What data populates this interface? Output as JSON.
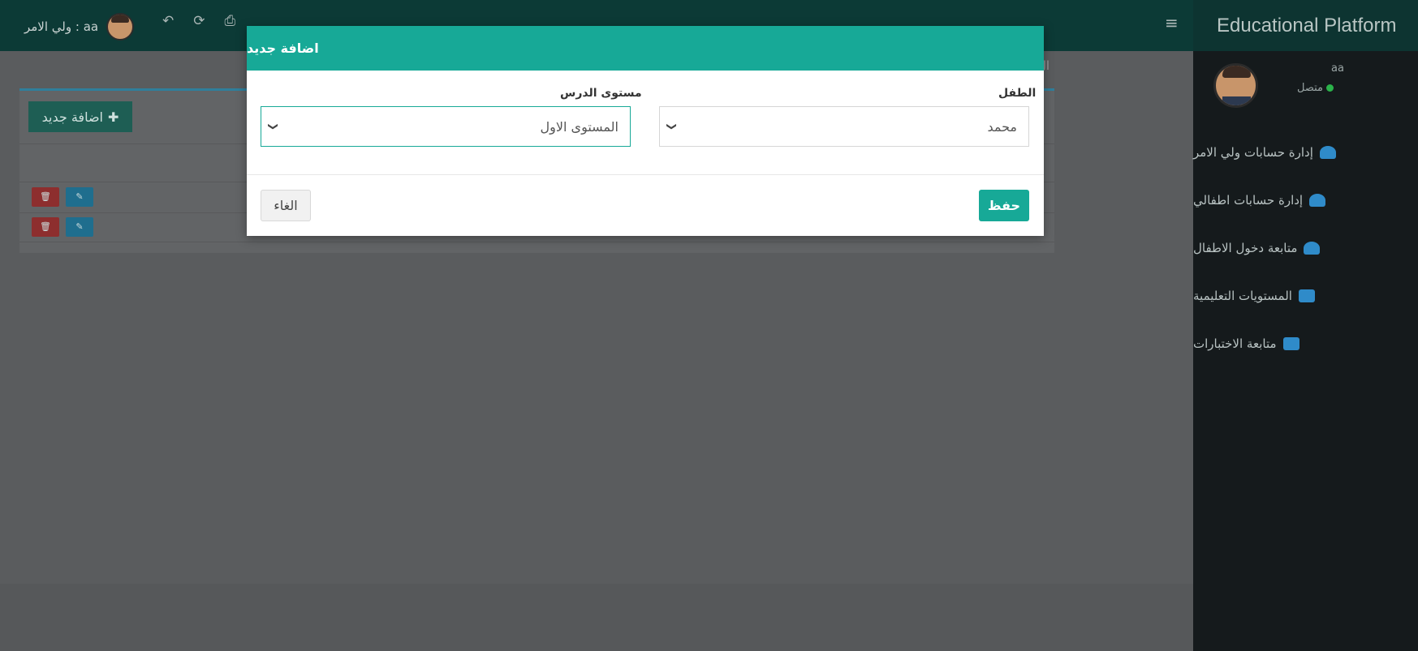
{
  "topbar": {
    "user_label": "ولي الامر : aa",
    "icons": [
      "reply-icon",
      "refresh-icon",
      "print-icon",
      "menu-icon"
    ]
  },
  "sidebar": {
    "brand": "Educational Platform",
    "profile": {
      "name": "aa",
      "status": "متصل",
      "status_color": "#2bb34a"
    },
    "items": [
      {
        "label": "إدارة حسابات ولي الامر",
        "icon": "user-icon"
      },
      {
        "label": "إدارة حسابات اطفالي",
        "icon": "users-icon"
      },
      {
        "label": "متابعة دخول الاطفال",
        "icon": "users-icon"
      },
      {
        "label": "المستويات التعليمية",
        "icon": "book-icon"
      },
      {
        "label": "متابعة الاختبارات",
        "icon": "book-icon"
      }
    ]
  },
  "content": {
    "add_button_label": "اضافة جديد",
    "partial_title": "ال"
  },
  "modal": {
    "title": "اضافة جديد",
    "child_label": "الطفل",
    "child_value": "محمد",
    "level_label": "مستوى الدرس",
    "level_value": "المستوى الاول",
    "save_label": "حفظ",
    "cancel_label": "الغاء"
  },
  "colors": {
    "accent": "#17a997",
    "sidebar_bg": "#151a1c",
    "topbar_bg": "#0c3a36"
  }
}
